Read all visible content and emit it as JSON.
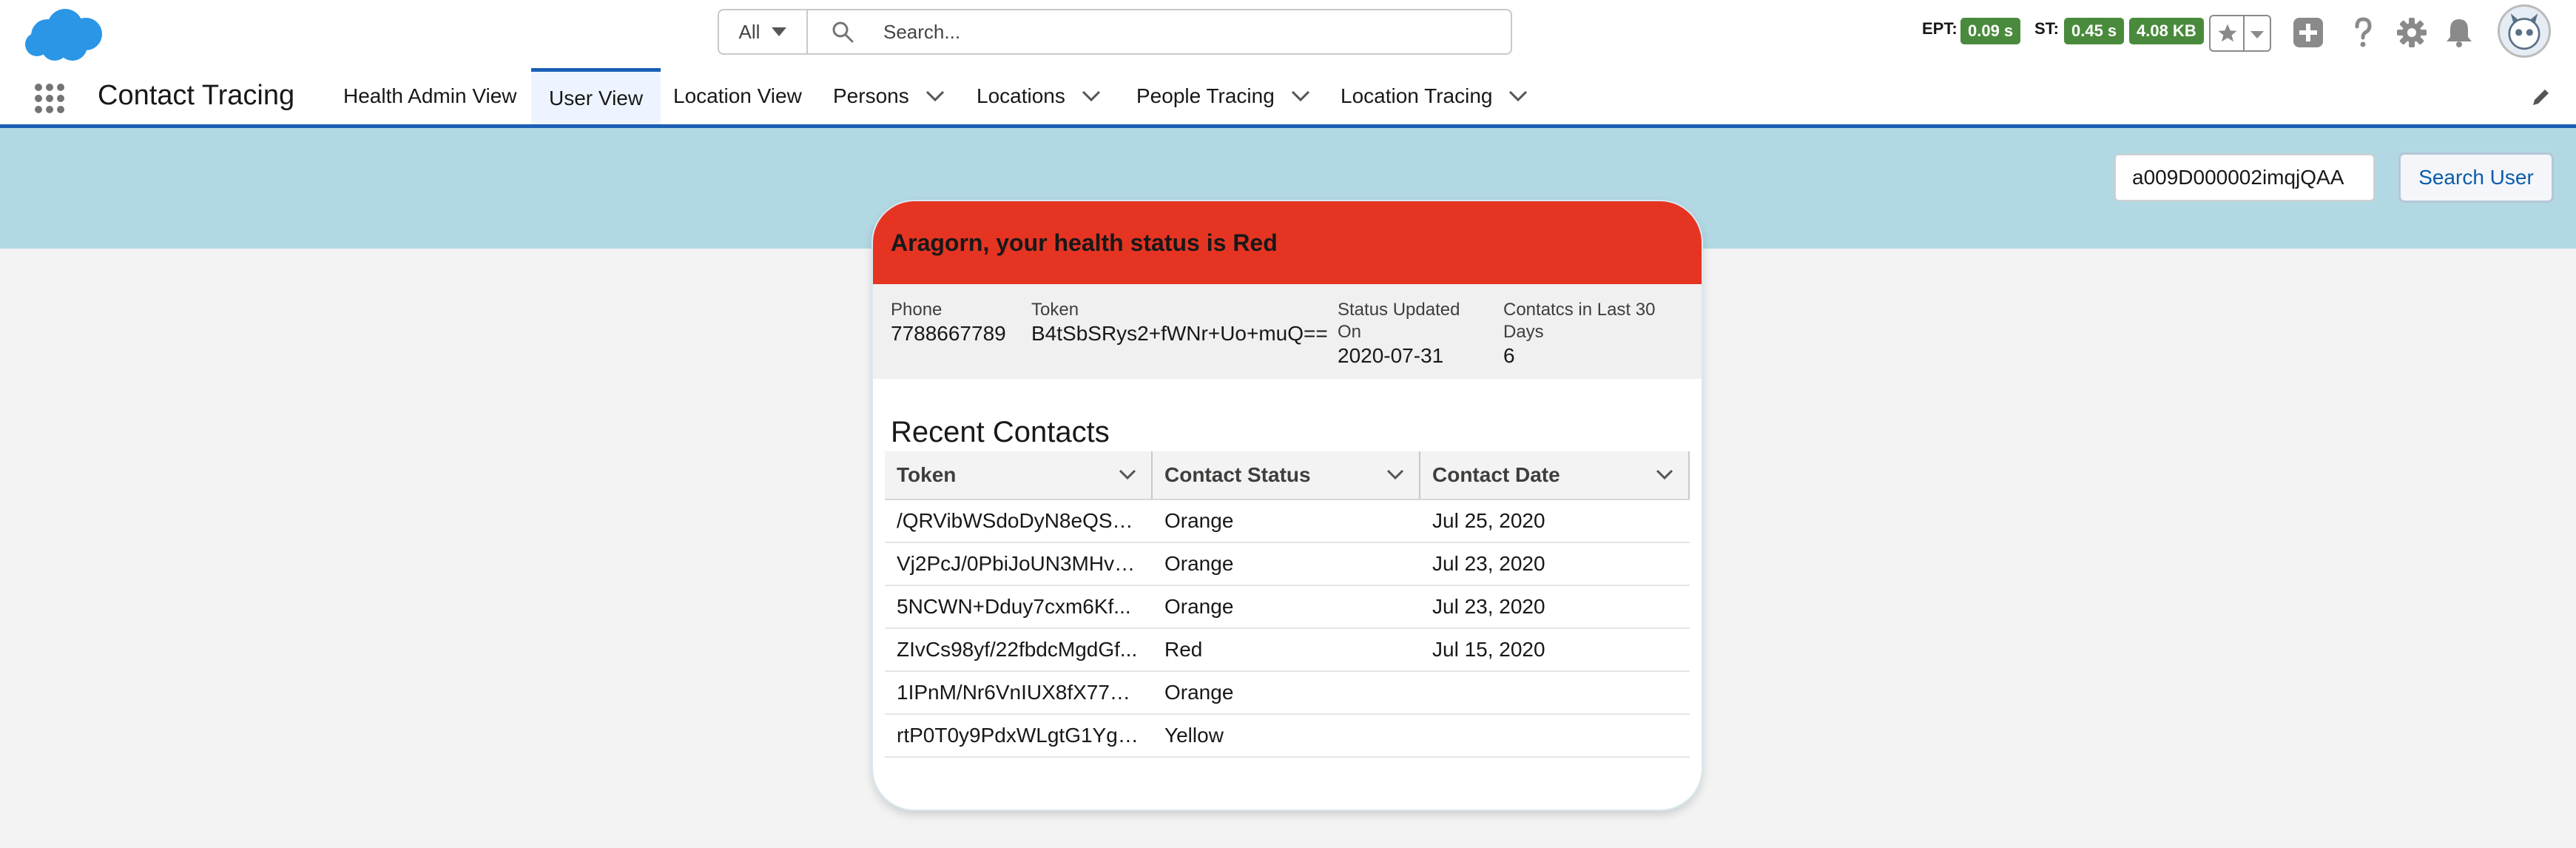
{
  "colors": {
    "brand": "#1b5fb5",
    "status_red": "#e63423",
    "band": "#b2d8e3",
    "perf_green": "#4a8a3c"
  },
  "global_header": {
    "search_scope": "All",
    "search_placeholder": "Search...",
    "perf": {
      "ept_label": "EPT:",
      "ept_value": "0.09 s",
      "st_label": "ST:",
      "st_value": "0.45 s",
      "size_value": "4.08 KB"
    }
  },
  "nav": {
    "app_name": "Contact Tracing",
    "items": [
      {
        "label": "Health Admin View",
        "active": false,
        "has_menu": false
      },
      {
        "label": "User View",
        "active": true,
        "has_menu": false
      },
      {
        "label": "Location View",
        "active": false,
        "has_menu": false
      },
      {
        "label": "Persons",
        "active": false,
        "has_menu": true
      },
      {
        "label": "Locations",
        "active": false,
        "has_menu": true
      },
      {
        "label": "People Tracing",
        "active": false,
        "has_menu": true
      },
      {
        "label": "Location Tracing",
        "active": false,
        "has_menu": true
      }
    ]
  },
  "user_search": {
    "value": "a009D000002imqjQAA",
    "button_label": "Search User"
  },
  "card": {
    "title": "Aragorn, your health status is Red",
    "status": "Red",
    "fields": {
      "phone_label": "Phone",
      "phone_value": "7788667789",
      "token_label": "Token",
      "token_value": "B4tSbSRys2+fWNr+Uo+muQ==",
      "status_updated_label_1": "Status Updated",
      "status_updated_label_2": "On",
      "status_updated_value": "2020-07-31",
      "contacts_label_1": "Contatcs in Last 30",
      "contacts_label_2": "Days",
      "contacts_value": "6"
    },
    "recent_title": "Recent Contacts",
    "columns": [
      "Token",
      "Contact Status",
      "Contact Date"
    ],
    "rows": [
      {
        "token": "/QRVibWSdoDyN8eQSC...",
        "status": "Orange",
        "date": "Jul 25, 2020"
      },
      {
        "token": "Vj2PcJ/0PbiJoUN3MHvN...",
        "status": "Orange",
        "date": "Jul 23, 2020"
      },
      {
        "token": "5NCWN+Dduy7cxm6Kf...",
        "status": "Orange",
        "date": "Jul 23, 2020"
      },
      {
        "token": "ZIvCs98yf/22fbdcMgdGf...",
        "status": "Red",
        "date": "Jul 15, 2020"
      },
      {
        "token": "1IPnM/Nr6VnIUX8fX77D...",
        "status": "Orange",
        "date": ""
      },
      {
        "token": "rtP0T0y9PdxWLgtG1YgIB...",
        "status": "Yellow",
        "date": ""
      }
    ]
  }
}
